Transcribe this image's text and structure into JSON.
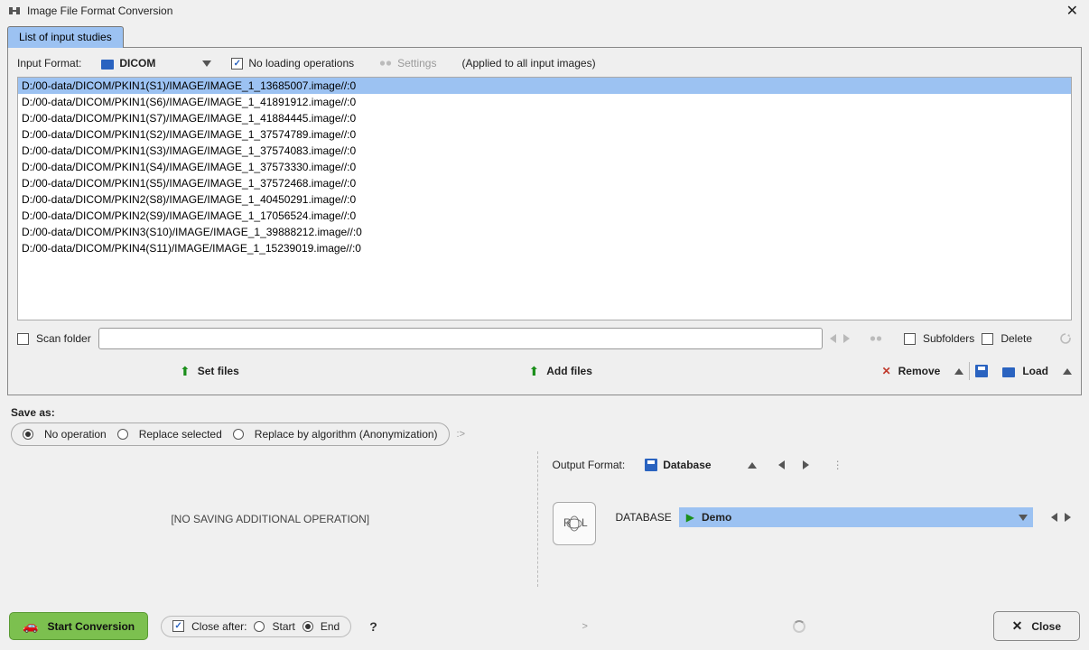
{
  "window": {
    "title": "Image File Format Conversion"
  },
  "tab": {
    "label": "List of input studies"
  },
  "inputFormat": {
    "label": "Input Format:",
    "value": "DICOM"
  },
  "noLoading": {
    "label": "No loading operations",
    "checked": true
  },
  "settings": {
    "label": "Settings"
  },
  "appliedText": "(Applied to all input images)",
  "files": [
    "D:/00-data/DICOM/PKIN1(S1)/IMAGE/IMAGE_1_13685007.image//:0",
    "D:/00-data/DICOM/PKIN1(S6)/IMAGE/IMAGE_1_41891912.image//:0",
    "D:/00-data/DICOM/PKIN1(S7)/IMAGE/IMAGE_1_41884445.image//:0",
    "D:/00-data/DICOM/PKIN1(S2)/IMAGE/IMAGE_1_37574789.image//:0",
    "D:/00-data/DICOM/PKIN1(S3)/IMAGE/IMAGE_1_37574083.image//:0",
    "D:/00-data/DICOM/PKIN1(S4)/IMAGE/IMAGE_1_37573330.image//:0",
    "D:/00-data/DICOM/PKIN1(S5)/IMAGE/IMAGE_1_37572468.image//:0",
    "D:/00-data/DICOM/PKIN2(S8)/IMAGE/IMAGE_1_40450291.image//:0",
    "D:/00-data/DICOM/PKIN2(S9)/IMAGE/IMAGE_1_17056524.image//:0",
    "D:/00-data/DICOM/PKIN3(S10)/IMAGE/IMAGE_1_39888212.image//:0",
    "D:/00-data/DICOM/PKIN4(S11)/IMAGE/IMAGE_1_15239019.image//:0"
  ],
  "scan": {
    "label": "Scan folder",
    "value": "",
    "subfolders": "Subfolders",
    "delete": "Delete"
  },
  "actions": {
    "setFiles": "Set files",
    "addFiles": "Add files",
    "remove": "Remove",
    "load": "Load"
  },
  "saveAs": {
    "heading": "Save as:",
    "options": {
      "noop": "No operation",
      "replaceSelected": "Replace selected",
      "replaceAlgo": "Replace by algorithm (Anonymization)"
    },
    "selected": "noop",
    "noSavingText": "[NO SAVING ADDITIONAL OPERATION]"
  },
  "output": {
    "label": "Output Format:",
    "value": "Database",
    "dbLabel": "DATABASE",
    "dbValue": "Demo"
  },
  "bottom": {
    "start": "Start Conversion",
    "closeAfter": "Close after:",
    "startRadio": "Start",
    "endRadio": "End",
    "closeAfterChecked": true,
    "closeAfterSelected": "end",
    "close": "Close"
  }
}
